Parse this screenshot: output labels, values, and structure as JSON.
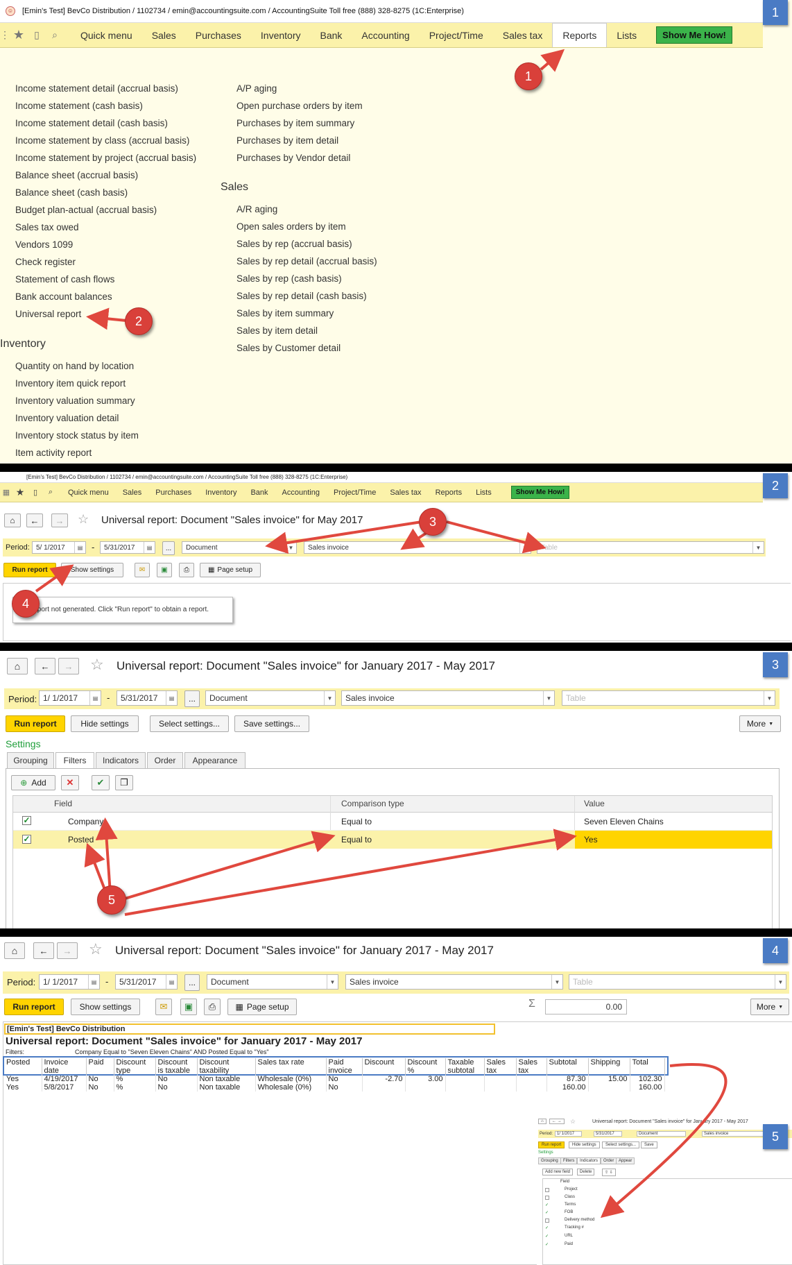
{
  "titlebar": {
    "text": "[Emin's Test] BevCo Distribution / 1102734 / emin@accountingsuite.com / AccountingSuite Toll free (888) 328-8275   (1C:Enterprise)"
  },
  "nav": {
    "items": [
      "Quick menu",
      "Sales",
      "Purchases",
      "Inventory",
      "Bank",
      "Accounting",
      "Project/Time",
      "Sales tax",
      "Reports",
      "Lists"
    ],
    "show_me": "Show Me How!"
  },
  "badges": [
    "1",
    "2",
    "3",
    "4",
    "5"
  ],
  "callouts": [
    "1",
    "2",
    "3",
    "4",
    "5"
  ],
  "panel1": {
    "left_items": [
      "Income statement detail (accrual basis)",
      "Income statement (cash basis)",
      "Income statement detail (cash basis)",
      "Income statement by class (accrual basis)",
      "Income statement by project (accrual basis)",
      "Balance sheet (accrual basis)",
      "Balance sheet (cash basis)",
      "Budget plan-actual (accrual basis)",
      "Sales tax owed",
      "Vendors 1099",
      "Check register",
      "Statement of cash flows",
      "Bank account balances",
      "Universal report"
    ],
    "inventory_title": "Inventory",
    "inventory_items": [
      "Quantity on hand by location",
      "Inventory item quick report",
      "Inventory valuation summary",
      "Inventory valuation detail",
      "Inventory stock status by item",
      "Item activity report"
    ],
    "purchase_items": [
      "A/P aging",
      "Open purchase orders by item",
      "Purchases by item summary",
      "Purchases by item detail",
      "Purchases by Vendor detail"
    ],
    "sales_title": "Sales",
    "sales_items": [
      "A/R aging",
      "Open sales orders by item",
      "Sales by rep (accrual basis)",
      "Sales by rep detail (accrual basis)",
      "Sales by rep (cash basis)",
      "Sales by rep detail (cash basis)",
      "Sales by item summary",
      "Sales by item detail",
      "Sales by Customer detail"
    ]
  },
  "panel2": {
    "title": "Universal report: Document \"Sales invoice\" for May 2017",
    "period_label": "Period:",
    "from": "5/ 1/2017",
    "to": "5/31/2017",
    "dots": "...",
    "kind": "Document",
    "doc": "Sales invoice",
    "table_ph": "Table",
    "run": "Run report",
    "show_settings": "Show settings",
    "page_setup": "Page setup",
    "message": "Report not generated. Click \"Run report\" to obtain a report."
  },
  "panel3": {
    "title": "Universal report: Document \"Sales invoice\" for January 2017 - May 2017",
    "period_label": "Period:",
    "from": "1/ 1/2017",
    "to": "5/31/2017",
    "dots": "...",
    "kind": "Document",
    "doc": "Sales invoice",
    "table_ph": "Table",
    "run": "Run report",
    "hide_settings": "Hide settings",
    "select_settings": "Select settings...",
    "save_settings": "Save settings...",
    "more": "More",
    "settings_label": "Settings",
    "tabs": [
      "Grouping",
      "Filters",
      "Indicators",
      "Order",
      "Appearance"
    ],
    "add": "Add",
    "col_field": "Field",
    "col_comparison": "Comparison type",
    "col_value": "Value",
    "rows": [
      {
        "field": "Company",
        "comparison": "Equal to",
        "value": "Seven Eleven Chains"
      },
      {
        "field": "Posted",
        "comparison": "Equal to",
        "value": "Yes"
      }
    ]
  },
  "panel4": {
    "title": "Universal report: Document \"Sales invoice\" for January 2017 - May 2017",
    "period_label": "Period:",
    "from": "1/ 1/2017",
    "to": "5/31/2017",
    "dots": "...",
    "kind": "Document",
    "doc": "Sales invoice",
    "table_ph": "Table",
    "run": "Run report",
    "show_settings": "Show settings",
    "page_setup": "Page setup",
    "sum_value": "0.00",
    "more": "More",
    "company": "[Emin's Test] BevCo Distribution",
    "report_title": "Universal report: Document \"Sales invoice\" for January 2017 - May 2017",
    "filters_label": "Filters:",
    "filters_text": "Company Equal to \"Seven Eleven Chains\" AND Posted Equal to \"Yes\"",
    "headers": [
      [
        "Posted",
        ""
      ],
      [
        "Invoice",
        "date"
      ],
      [
        "Paid",
        ""
      ],
      [
        "Discount",
        "type"
      ],
      [
        "Discount",
        "is taxable"
      ],
      [
        "Discount",
        "taxability"
      ],
      [
        "Sales tax rate",
        ""
      ],
      [
        "Paid",
        "invoice"
      ],
      [
        "Discount",
        ""
      ],
      [
        "Discount",
        "%"
      ],
      [
        "Taxable",
        "subtotal"
      ],
      [
        "Sales",
        "tax"
      ],
      [
        "Sales",
        "tax"
      ],
      [
        "Subtotal",
        ""
      ],
      [
        "Shipping",
        ""
      ],
      [
        "Total",
        ""
      ]
    ],
    "rows": [
      [
        "Yes",
        "4/19/2017",
        "No",
        "%",
        "No",
        "Non taxable",
        "Wholesale (0%)",
        "No",
        "-2.70",
        "3.00",
        "",
        "",
        "",
        "87.30",
        "15.00",
        "102.30"
      ],
      [
        "Yes",
        "5/8/2017",
        "No",
        "%",
        "No",
        "Non taxable",
        "Wholesale (0%)",
        "No",
        "",
        "",
        "",
        "",
        "",
        "160.00",
        "",
        "160.00"
      ]
    ],
    "mini": {
      "title": "Universal report: Document \"Sales invoice\" for January 2017 - May 2017",
      "period_label": "Period:",
      "from": "1/ 1/2017",
      "to": "5/31/2017",
      "kind": "Document",
      "doc": "Sales invoice",
      "run": "Run report",
      "hide": "Hide settings",
      "select": "Select settings...",
      "save": "Save",
      "settings": "Settings",
      "tabs": [
        "Grouping",
        "Filters",
        "Indicators",
        "Order",
        "Appear"
      ],
      "add_field": "Add new field",
      "delete": "Delete",
      "field_header": "Field",
      "fields": [
        {
          "name": "Project",
          "checked": false
        },
        {
          "name": "Class",
          "checked": false
        },
        {
          "name": "Terms",
          "checked": true
        },
        {
          "name": "FOB",
          "checked": true
        },
        {
          "name": "Delivery method",
          "checked": false
        },
        {
          "name": "Tracking #",
          "checked": true
        },
        {
          "name": "URL",
          "checked": true
        },
        {
          "name": "Paid",
          "checked": true
        }
      ]
    }
  }
}
